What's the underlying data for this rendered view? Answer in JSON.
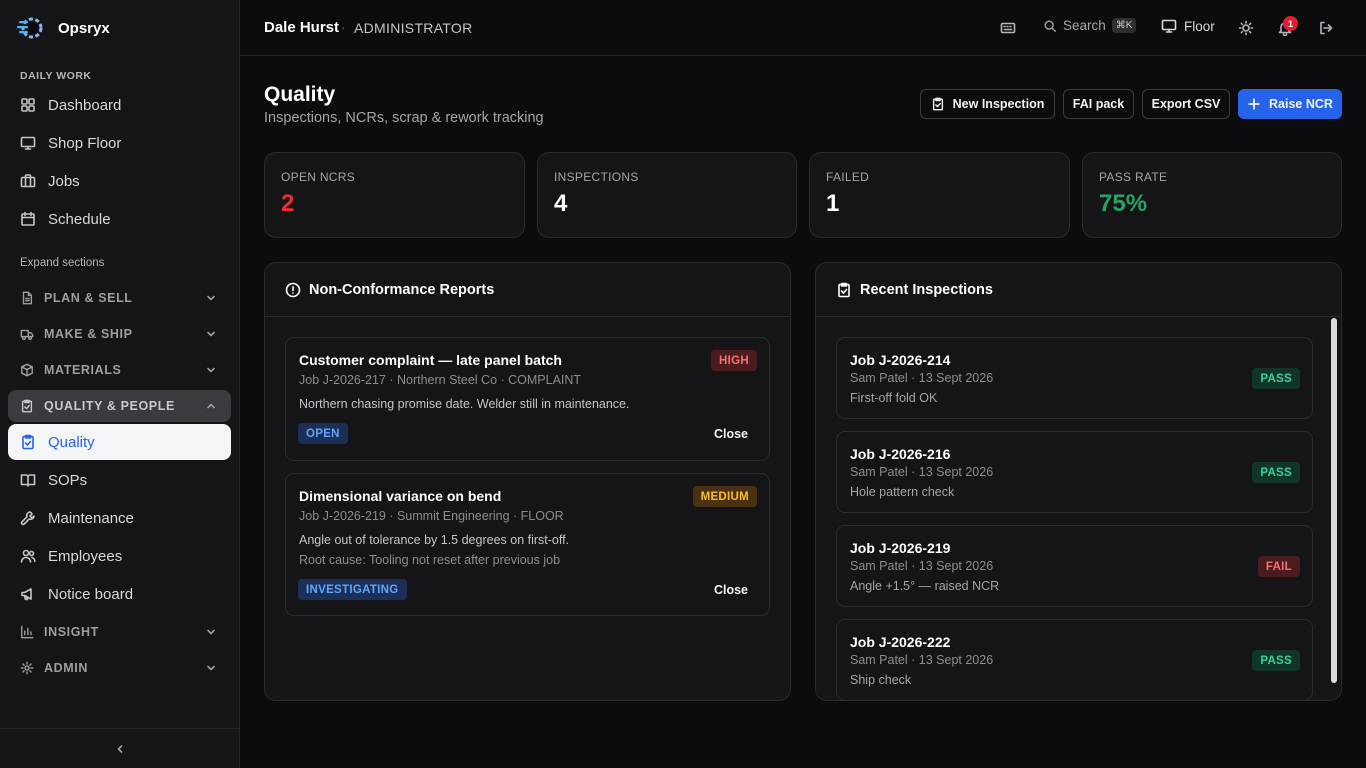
{
  "app": {
    "name": "Opsryx"
  },
  "user": {
    "name": "Dale Hurst",
    "separator": "·",
    "role": "ADMINISTRATOR"
  },
  "topbar": {
    "search_label": "Search",
    "search_shortcut": "⌘K",
    "floor_label": "Floor",
    "notification_count": "1"
  },
  "sidebar": {
    "daily_label": "DAILY WORK",
    "daily_items": [
      {
        "label": "Dashboard",
        "icon": "grid-icon"
      },
      {
        "label": "Shop Floor",
        "icon": "monitor-icon"
      },
      {
        "label": "Jobs",
        "icon": "briefcase-icon"
      },
      {
        "label": "Schedule",
        "icon": "calendar-icon"
      }
    ],
    "expand_label": "Expand sections",
    "groups": [
      {
        "label": "PLAN & SELL",
        "icon": "document-icon",
        "open": false
      },
      {
        "label": "MAKE & SHIP",
        "icon": "truck-icon",
        "open": false
      },
      {
        "label": "MATERIALS",
        "icon": "box-icon",
        "open": false
      },
      {
        "label": "QUALITY & PEOPLE",
        "icon": "clipboard-icon",
        "open": true
      },
      {
        "label": "INSIGHT",
        "icon": "bar-chart-icon",
        "open": false
      },
      {
        "label": "ADMIN",
        "icon": "gear-icon",
        "open": false
      }
    ],
    "quality_items": [
      {
        "label": "Quality",
        "icon": "clipboard-check-icon",
        "active": true
      },
      {
        "label": "SOPs",
        "icon": "book-icon"
      },
      {
        "label": "Maintenance",
        "icon": "wrench-icon"
      },
      {
        "label": "Employees",
        "icon": "users-icon"
      },
      {
        "label": "Notice board",
        "icon": "megaphone-icon"
      }
    ]
  },
  "page": {
    "title": "Quality",
    "subtitle": "Inspections, NCRs, scrap & rework tracking",
    "actions": {
      "new_inspection": "New Inspection",
      "fai_pack": "FAI pack",
      "export_csv": "Export CSV",
      "raise_ncr": "Raise NCR"
    }
  },
  "stats": [
    {
      "label": "OPEN NCRS",
      "value": "2",
      "color": "#ef2b35"
    },
    {
      "label": "INSPECTIONS",
      "value": "4",
      "color": "#ffffff"
    },
    {
      "label": "FAILED",
      "value": "1",
      "color": "#ffffff"
    },
    {
      "label": "PASS RATE",
      "value": "75%",
      "color": "#22a565"
    }
  ],
  "ncr_panel": {
    "title": "Non-Conformance Reports",
    "items": [
      {
        "title": "Customer complaint — late panel batch",
        "meta": "Job J-2026-217 · Northern Steel Co · COMPLAINT",
        "description": "Northern chasing promise date. Welder still in maintenance.",
        "root_cause": "",
        "severity": "HIGH",
        "status": "OPEN",
        "close_label": "Close"
      },
      {
        "title": "Dimensional variance on bend",
        "meta": "Job J-2026-219 · Summit Engineering · FLOOR",
        "description": "Angle out of tolerance by 1.5 degrees on first-off.",
        "root_cause": "Root cause: Tooling not reset after previous job",
        "severity": "MEDIUM",
        "status": "INVESTIGATING",
        "close_label": "Close"
      }
    ]
  },
  "inspections_panel": {
    "title": "Recent Inspections",
    "items": [
      {
        "job": "Job J-2026-214",
        "meta": "Sam Patel · 13 Sept 2026",
        "note": "First-off fold OK",
        "result": "PASS"
      },
      {
        "job": "Job J-2026-216",
        "meta": "Sam Patel · 13 Sept 2026",
        "note": "Hole pattern check",
        "result": "PASS"
      },
      {
        "job": "Job J-2026-219",
        "meta": "Sam Patel · 13 Sept 2026",
        "note": "Angle +1.5° — raised NCR",
        "result": "FAIL"
      },
      {
        "job": "Job J-2026-222",
        "meta": "Sam Patel · 13 Sept 2026",
        "note": "Ship check",
        "result": "PASS"
      }
    ]
  },
  "colors": {
    "accent": "#2563eb",
    "danger": "#ef2b35",
    "success": "#22a565"
  }
}
